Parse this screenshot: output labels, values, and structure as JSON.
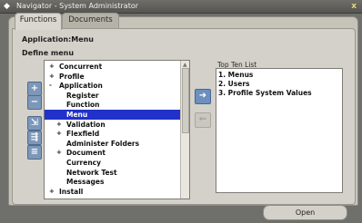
{
  "window": {
    "title": "Navigator - System Administrator",
    "close_label": "x"
  },
  "tabs": [
    {
      "label": "Functions",
      "active": true
    },
    {
      "label": "Documents",
      "active": false
    }
  ],
  "headings": {
    "context": "Application:Menu",
    "define": "Define menu"
  },
  "tree": {
    "items": [
      {
        "label": "Concurrent",
        "bullet": "+",
        "indent": 0,
        "selected": false
      },
      {
        "label": "Profile",
        "bullet": "+",
        "indent": 0,
        "selected": false
      },
      {
        "label": "Application",
        "bullet": "-",
        "indent": 0,
        "selected": false
      },
      {
        "label": "Register",
        "bullet": "",
        "indent": 1,
        "selected": false
      },
      {
        "label": "Function",
        "bullet": "",
        "indent": 1,
        "selected": false
      },
      {
        "label": "Menu",
        "bullet": "",
        "indent": 1,
        "selected": true
      },
      {
        "label": "Validation",
        "bullet": "+",
        "indent": 1,
        "selected": false
      },
      {
        "label": "Flexfield",
        "bullet": "+",
        "indent": 1,
        "selected": false
      },
      {
        "label": "Administer Folders",
        "bullet": "",
        "indent": 1,
        "selected": false
      },
      {
        "label": "Document",
        "bullet": "+",
        "indent": 1,
        "selected": false
      },
      {
        "label": "Currency",
        "bullet": "",
        "indent": 1,
        "selected": false
      },
      {
        "label": "Network Test",
        "bullet": "",
        "indent": 1,
        "selected": false
      },
      {
        "label": "Messages",
        "bullet": "",
        "indent": 1,
        "selected": false
      },
      {
        "label": "Install",
        "bullet": "+",
        "indent": 0,
        "selected": false
      }
    ]
  },
  "side_buttons": [
    {
      "name": "expand-button",
      "glyph": "+"
    },
    {
      "name": "collapse-button",
      "glyph": "−"
    },
    {
      "name": "expand-branch-button",
      "glyph": "⇲"
    },
    {
      "name": "expand-all-button",
      "glyph": "⇶"
    },
    {
      "name": "collapse-all-button",
      "glyph": "≡"
    }
  ],
  "move_buttons": {
    "add_glyph": "➜",
    "remove_glyph": "⇐"
  },
  "top_ten": {
    "label": "Top Ten List",
    "items": [
      "1. Menus",
      "2. Users",
      "3. Profile System Values"
    ]
  },
  "open_button": {
    "label": "Open"
  },
  "colors": {
    "selection": "#2131c9",
    "tool_button": "#7d97b8",
    "frame": "#c6c3b8"
  }
}
